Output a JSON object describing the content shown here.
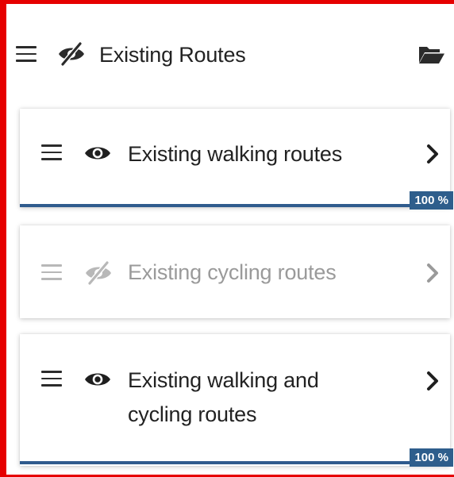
{
  "header": {
    "title": "Existing Routes",
    "visibility_icon": "eye-slash-icon",
    "folder_icon": "folder-open-icon"
  },
  "layers": [
    {
      "label": "Existing walking routes",
      "visible": true,
      "enabled": true,
      "visibility_icon": "eye-icon",
      "progress_label": "100 %",
      "progress": 1.0
    },
    {
      "label": "Existing cycling routes",
      "visible": false,
      "enabled": false,
      "visibility_icon": "eye-slash-icon"
    },
    {
      "label_line1": "Existing walking and",
      "label_line2": "cycling routes",
      "visible": true,
      "enabled": true,
      "visibility_icon": "eye-icon",
      "progress_label": "100 %",
      "progress": 1.0
    }
  ],
  "colors": {
    "frame": "#e60000",
    "progress": "#2f5b8d",
    "badge": "#2e5e8c"
  }
}
